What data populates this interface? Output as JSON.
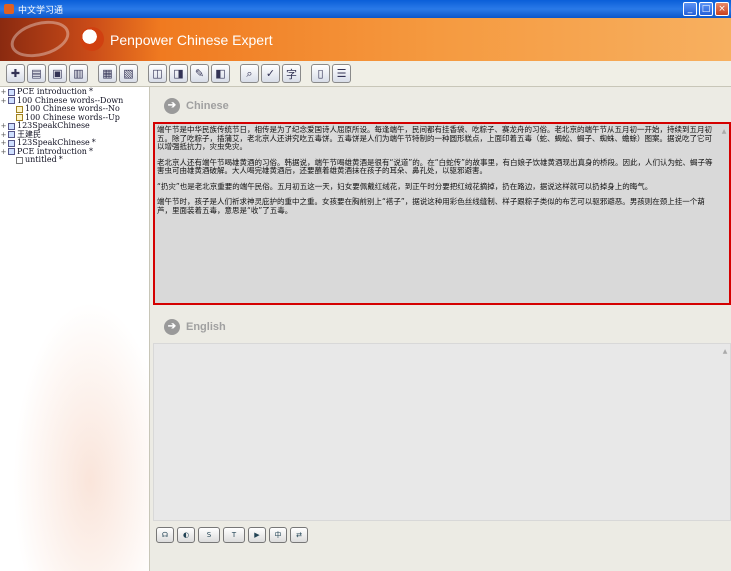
{
  "window": {
    "title": "中文学习通",
    "controls": [
      "_",
      "□",
      "×"
    ]
  },
  "banner": {
    "product_name": "Penpower Chinese Expert"
  },
  "toolbar": {
    "buttons": [
      {
        "icon": "new-icon",
        "glyph": "✚"
      },
      {
        "icon": "open-icon",
        "glyph": "▤"
      },
      {
        "icon": "save-icon",
        "glyph": "▣"
      },
      {
        "icon": "save-as-icon",
        "glyph": "▥"
      },
      {
        "icon": "print-icon",
        "glyph": "▦"
      },
      {
        "icon": "export-icon",
        "glyph": "▧"
      },
      {
        "icon": "dictionary-icon",
        "glyph": "◫"
      },
      {
        "icon": "lookup-icon",
        "glyph": "◨"
      },
      {
        "icon": "note-icon",
        "glyph": "✎"
      },
      {
        "icon": "tag-icon",
        "glyph": "◧"
      },
      {
        "icon": "search-icon",
        "glyph": "⌕"
      },
      {
        "icon": "check-icon",
        "glyph": "✓"
      },
      {
        "icon": "translate-icon",
        "glyph": "字"
      },
      {
        "icon": "document-icon",
        "glyph": "▯"
      },
      {
        "icon": "list-icon",
        "glyph": "☰"
      }
    ]
  },
  "tree": {
    "items": [
      {
        "label": "PCE introduction",
        "mark": "*",
        "level": 0,
        "expander": "+",
        "icon": "book"
      },
      {
        "label": "100 Chinese words--Down",
        "mark": "",
        "level": 0,
        "expander": "+",
        "icon": "book"
      },
      {
        "label": "100 Chinese words--No",
        "mark": "",
        "level": 1,
        "expander": "",
        "icon": "doc"
      },
      {
        "label": "100 Chinese words--Up",
        "mark": "",
        "level": 1,
        "expander": "",
        "icon": "doc"
      },
      {
        "label": "123SpeakChinese",
        "mark": "",
        "level": 0,
        "expander": "+",
        "icon": "book"
      },
      {
        "label": "王建民",
        "mark": "",
        "level": 0,
        "expander": "+",
        "icon": "book"
      },
      {
        "label": "123SpeakChinese",
        "mark": "*",
        "level": 0,
        "expander": "+",
        "icon": "book"
      },
      {
        "label": "PCE introduction",
        "mark": "*",
        "level": 0,
        "expander": "+",
        "icon": "book"
      },
      {
        "label": "untitled",
        "mark": "*",
        "level": 1,
        "expander": "",
        "icon": "file"
      }
    ]
  },
  "chinese_pane": {
    "heading": "Chinese",
    "paragraphs": [
      "端午节是中华民族传统节日，相传是为了纪念爱国诗人屈原所设。每逢端午，民间都有挂香袋、吃粽子、赛龙舟的习俗。老北京的端午节从五月初一开始，持续到五月初五。除了吃粽子，插蒲艾，老北京人还讲究吃五毒饼。五毒饼是人们为端午节特制的一种圆形糕点，上面印着五毒（蛇、蝎蚣、蝎子、蜘蛛、蟾蜍）图案。据说吃了它可以增强抵抗力，灾虫免灾。",
      "老北京人还有端午节喝雄黄酒的习俗。韩据说，端午节喝雄黄酒是很有“说道”的。在“白蛇传”的故事里，有白娘子饮雄黄酒现出真身的桥段。因此，人们认为蛇、蝎子等害虫可由雄黄酒破解。大人喝完雄黄酒后，还要蘸着雄黄酒抹在孩子的耳朵、鼻孔处，以驱邪避害。",
      "“扔灾”也是老北京重要的端午民俗。五月初五这一天，妇女要佩戴红绒花，到正午时分要把红绒花摘掉，扔在路边，据说这样就可以扔掉身上的晦气。",
      "端午节时，孩子是人们祈求神灵庇护的重中之重。女孩要在胸前别上“褡子”，据说这种用彩色丝线缝制、样子跟粽子类似的布艺可以驱邪避恶。男孩则在颈上挂一个葫芦，里面装着五毒，意思是“收”了五毒。"
    ]
  },
  "english_pane": {
    "heading": "English"
  },
  "bottom_toolbar": {
    "buttons": [
      {
        "icon": "speak-icon",
        "text": "☊"
      },
      {
        "icon": "record-icon",
        "text": "◐"
      },
      {
        "icon": "chinese-simplified-icon",
        "text": "S"
      },
      {
        "icon": "chinese-traditional-icon",
        "text": "T"
      },
      {
        "icon": "play-icon",
        "text": "▶"
      },
      {
        "icon": "convert-icon",
        "text": "中"
      },
      {
        "icon": "translate-button-icon",
        "text": "⇄"
      }
    ]
  }
}
